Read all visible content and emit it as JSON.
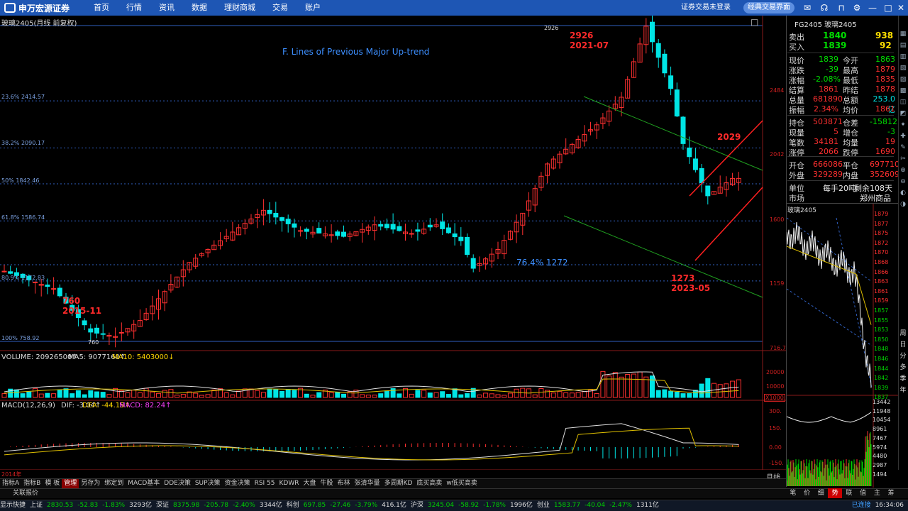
{
  "app": {
    "logo_text": "申万宏源证券",
    "nav": [
      "首页",
      "行情",
      "资讯",
      "数据",
      "理财商城",
      "交易",
      "账户"
    ],
    "login_status": "证券交易未登录",
    "classic_button": "经典交易界面"
  },
  "chart": {
    "title": "玻璃2405(月线 前复权)",
    "heading": "F. Lines of Previous Major Up-trend",
    "fib_levels": [
      {
        "label": "23.6% 2414.57"
      },
      {
        "label": "38.2% 2090.17"
      },
      {
        "label": "50% 1842.46"
      },
      {
        "label": "61.8% 1586.74"
      },
      {
        "label": "80.9% 1172.83"
      },
      {
        "label": "100% 758.92"
      }
    ],
    "annotations": {
      "high_price": "2926",
      "high_date": "2021-07",
      "low_price": "760",
      "low_date": "2015-11",
      "recent_low_price": "1273",
      "recent_low_date": "2023-05",
      "recent_high": "2029",
      "retrace": "76.4% 1272",
      "peak_tick": "2926",
      "low_tick": "760"
    },
    "price_axis": [
      "2484",
      "2042",
      "1600",
      "1159",
      "716.7"
    ],
    "volume_header": {
      "volume": "VOLUME: 20926500↑",
      "ma5": "MA5: 9077160↑",
      "ma10": "MA10: 5403000↓"
    },
    "volume_axis": [
      "20000",
      "10000",
      "X1000"
    ],
    "macd_header": {
      "macd_name": "MACD(12,26,9)",
      "dif": "DIF: -3.04↑",
      "dea": "DEA: -44.15↑",
      "macd": "MACD: 82.24↑"
    },
    "macd_axis": [
      "300.",
      "150.",
      "0.00",
      "-150."
    ],
    "x_start_label": "2014年",
    "month_label": "月线"
  },
  "quote": {
    "symbol": "FG2405 玻璃2405",
    "sell_label": "卖出",
    "sell_price": "1840",
    "sell_vol": "938",
    "buy_label": "买入",
    "buy_price": "1839",
    "buy_vol": "92",
    "rows": [
      [
        "现价",
        "1839",
        "今开",
        "1863"
      ],
      [
        "涨跌",
        "-39",
        "最高",
        "1879"
      ],
      [
        "涨幅",
        "-2.08%",
        "最低",
        "1835"
      ],
      [
        "结算",
        "1861",
        "昨结",
        "1878"
      ],
      [
        "总量",
        "681890",
        "总额",
        "253.0亿"
      ],
      [
        "振幅",
        "2.34%",
        "均价",
        "1861"
      ],
      [
        "持仓",
        "503871",
        "仓差",
        "-15812"
      ],
      [
        "现量",
        "5",
        "增仓",
        "-3"
      ],
      [
        "笔数",
        "34181",
        "均量",
        "19"
      ],
      [
        "涨停",
        "2066",
        "跌停",
        "1690"
      ],
      [
        "开仓",
        "666086",
        "平仓",
        "697710"
      ],
      [
        "外盘",
        "329289",
        "内盘",
        "352609"
      ]
    ],
    "unit_label": "单位",
    "unit_value": "每手20吨",
    "remain_value": "剩余108天",
    "market_label": "市场",
    "market_value": "郑州商品"
  },
  "mini_chart": {
    "title": "玻璃2405",
    "price_ticks": [
      "1879",
      "1877",
      "1875",
      "1872",
      "1870",
      "1868",
      "1866",
      "1863",
      "1861",
      "1859",
      "1857",
      "1855",
      "1853",
      "1850",
      "1848",
      "1846",
      "1844",
      "1842",
      "1839",
      "1837"
    ],
    "vol_ticks": [
      "13442",
      "11948",
      "10454",
      "8961",
      "7467",
      "5974",
      "4480",
      "2987",
      "1494"
    ]
  },
  "tabs": [
    "指标A",
    "指标B",
    "模 板",
    "管理",
    "另存为",
    "绑定到",
    "MACD基本",
    "DDE决策",
    "SUP决策",
    "资金决策",
    "RSI 55",
    "KDWR",
    "大盘",
    "牛股",
    "布林",
    "张清华量",
    "多周期KD",
    "底买高卖",
    "w低买高卖"
  ],
  "active_tab": "管理",
  "related_quote": "关联报价",
  "right_tabs": [
    "笔",
    "价",
    "细",
    "势",
    "联",
    "值",
    "主",
    "筹"
  ],
  "active_right_tab": "势",
  "status": {
    "items": [
      {
        "t": "显示快捷",
        "c": "w"
      },
      {
        "t": "上证",
        "c": "w"
      },
      {
        "t": "2830.53",
        "c": "g"
      },
      {
        "t": "-52.83",
        "c": "g"
      },
      {
        "t": "-1.83%",
        "c": "g"
      },
      {
        "t": "3293亿",
        "c": "w"
      },
      {
        "t": "深证",
        "c": "w"
      },
      {
        "t": "8375.98",
        "c": "g"
      },
      {
        "t": "-205.78",
        "c": "g"
      },
      {
        "t": "-2.40%",
        "c": "g"
      },
      {
        "t": "3344亿",
        "c": "w"
      },
      {
        "t": "科创",
        "c": "w"
      },
      {
        "t": "697.85",
        "c": "g"
      },
      {
        "t": "-27.46",
        "c": "g"
      },
      {
        "t": "-3.79%",
        "c": "g"
      },
      {
        "t": "416.1亿",
        "c": "w"
      },
      {
        "t": "沪深",
        "c": "w"
      },
      {
        "t": "3245.04",
        "c": "g"
      },
      {
        "t": "-58.92",
        "c": "g"
      },
      {
        "t": "-1.78%",
        "c": "g"
      },
      {
        "t": "1996亿",
        "c": "w"
      },
      {
        "t": "创业",
        "c": "w"
      },
      {
        "t": "1583.77",
        "c": "g"
      },
      {
        "t": "-40.04",
        "c": "g"
      },
      {
        "t": "-2.47%",
        "c": "g"
      },
      {
        "t": "1311亿",
        "c": "w"
      }
    ],
    "connection": "已连接",
    "time": "16:34:06"
  }
}
